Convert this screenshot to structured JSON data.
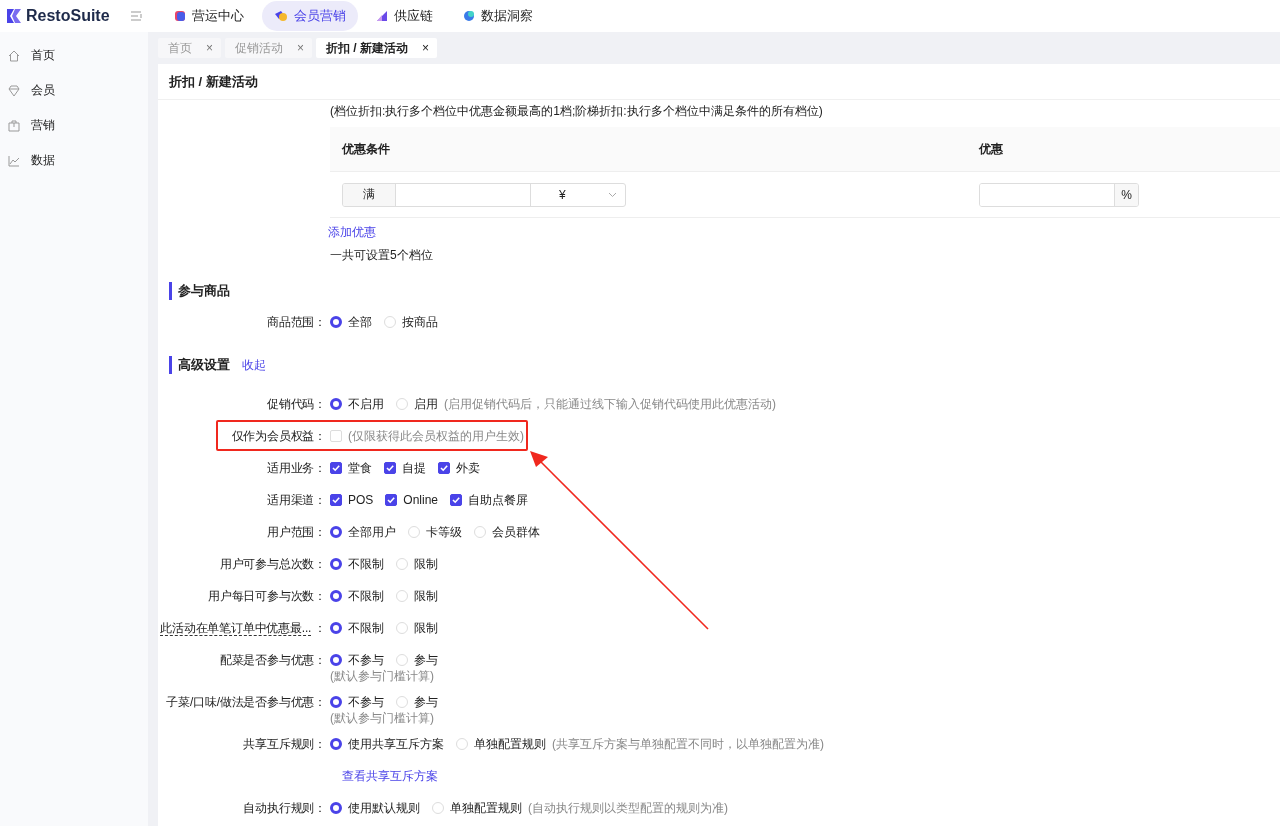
{
  "top_nav": {
    "brand": "RestoSuite",
    "modules": [
      {
        "label": "营运中心",
        "selected": false
      },
      {
        "label": "会员营销",
        "selected": true
      },
      {
        "label": "供应链",
        "selected": false
      },
      {
        "label": "数据洞察",
        "selected": false
      }
    ]
  },
  "sidebar": {
    "items": [
      {
        "label": "首页"
      },
      {
        "label": "会员"
      },
      {
        "label": "营销"
      },
      {
        "label": "数据"
      }
    ]
  },
  "tabs": [
    {
      "label": "首页",
      "selected": false,
      "close": "×"
    },
    {
      "label": "促销活动",
      "selected": false,
      "close": "×"
    },
    {
      "label": "折扣 / 新建活动",
      "selected": true,
      "close": "×"
    }
  ],
  "page_title": "折扣 / 新建活动",
  "tier_note": "(档位折扣:执行多个档位中优惠金额最高的1档;阶梯折扣:执行多个档位中满足条件的所有档位)",
  "tier_table": {
    "columns": [
      "优惠条件",
      "优惠"
    ],
    "rows": [
      {
        "prefix": "满",
        "currency": "¥",
        "unit": "%"
      }
    ]
  },
  "add_link": "添加优惠",
  "limit_note": "一共可设置5个档位",
  "sections": [
    {
      "title": "参与商品",
      "fields": [
        {
          "label": "商品范围：",
          "kind": "radio",
          "options": [
            {
              "label": "全部",
              "selected": true
            },
            {
              "label": "按商品",
              "selected": false
            }
          ]
        }
      ]
    },
    {
      "title": "高级设置",
      "action": "收起",
      "fields": [
        {
          "label": "促销代码：",
          "kind": "radio",
          "options": [
            {
              "label": "不启用",
              "selected": true
            },
            {
              "label": "启用",
              "selected": false
            }
          ],
          "note": "(启用促销代码后，只能通过线下输入促销代码使用此优惠活动)"
        },
        {
          "label": "仅作为会员权益：",
          "kind": "checkbox",
          "options": [
            {
              "checked": false
            }
          ],
          "note": "(仅限获得此会员权益的用户生效)",
          "highlighted": true
        },
        {
          "label": "适用业务：",
          "kind": "checkbox",
          "options": [
            {
              "label": "堂食",
              "checked": true
            },
            {
              "label": "自提",
              "checked": true
            },
            {
              "label": "外卖",
              "checked": true
            }
          ]
        },
        {
          "label": "适用渠道：",
          "kind": "checkbox",
          "options": [
            {
              "label": "POS",
              "checked": true
            },
            {
              "label": "Online",
              "checked": true
            },
            {
              "label": "自助点餐屏",
              "checked": true
            }
          ]
        },
        {
          "label": "用户范围：",
          "kind": "radio",
          "options": [
            {
              "label": "全部用户",
              "selected": true
            },
            {
              "label": "卡等级",
              "selected": false
            },
            {
              "label": "会员群体",
              "selected": false
            }
          ]
        },
        {
          "label": "用户可参与总次数：",
          "kind": "radio",
          "options": [
            {
              "label": "不限制",
              "selected": true
            },
            {
              "label": "限制",
              "selected": false
            }
          ]
        },
        {
          "label": "用户每日可参与次数：",
          "kind": "radio",
          "options": [
            {
              "label": "不限制",
              "selected": true
            },
            {
              "label": "限制",
              "selected": false
            }
          ]
        },
        {
          "label": "此活动在单笔订单中优惠最...",
          "colon": "：",
          "abbreviated": true,
          "kind": "radio",
          "options": [
            {
              "label": "不限制",
              "selected": true
            },
            {
              "label": "限制",
              "selected": false
            }
          ]
        },
        {
          "label": "配菜是否参与优惠：",
          "kind": "radio",
          "options": [
            {
              "label": "不参与",
              "selected": true
            },
            {
              "label": "参与",
              "selected": false
            }
          ],
          "sub_note": "(默认参与门槛计算)"
        },
        {
          "label": "子菜/口味/做法是否参与优惠：",
          "kind": "radio",
          "options": [
            {
              "label": "不参与",
              "selected": true
            },
            {
              "label": "参与",
              "selected": false
            }
          ],
          "sub_note": "(默认参与门槛计算)"
        },
        {
          "label": "共享互斥规则：",
          "kind": "radio",
          "options": [
            {
              "label": "使用共享互斥方案",
              "selected": true
            },
            {
              "label": "单独配置规则",
              "selected": false
            }
          ],
          "note": "(共享互斥方案与单独配置不同时，以单独配置为准)"
        },
        {
          "kind": "link",
          "link": "查看共享互斥方案"
        },
        {
          "label": "自动执行规则：",
          "kind": "radio",
          "options": [
            {
              "label": "使用默认规则",
              "selected": true
            },
            {
              "label": "单独配置规则",
              "selected": false
            }
          ],
          "note": "(自动执行规则以类型配置的规则为准)"
        }
      ]
    }
  ]
}
